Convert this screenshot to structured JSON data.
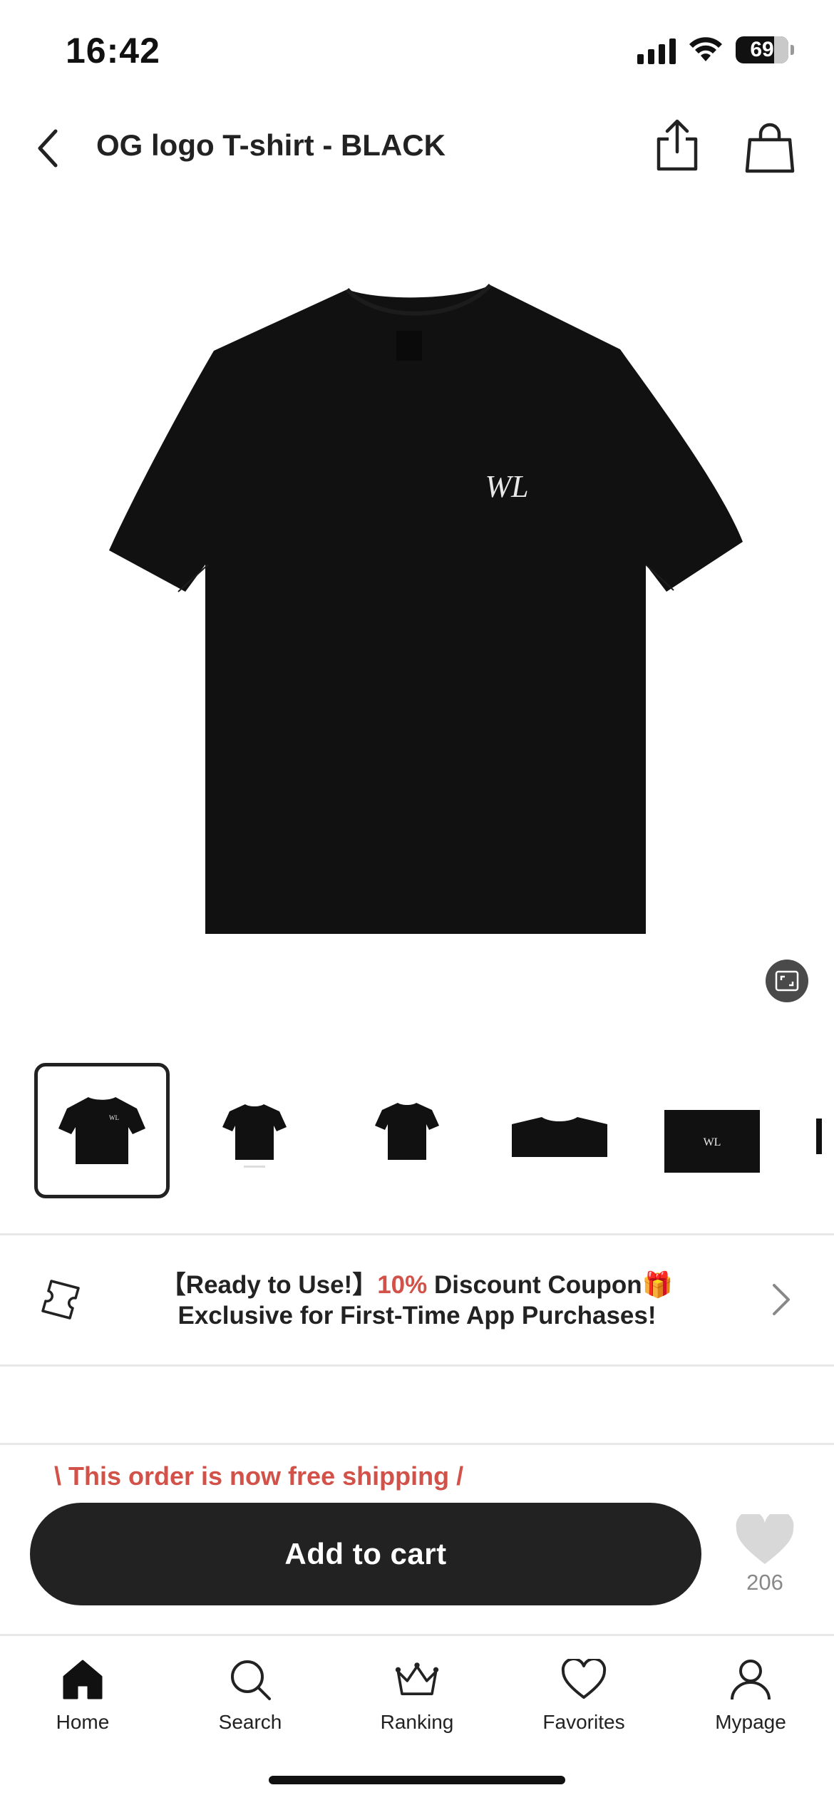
{
  "status_bar": {
    "time": "16:42",
    "battery": "69",
    "icons": [
      "signal-icon",
      "wifi-icon",
      "battery-icon"
    ]
  },
  "header": {
    "title": "OG logo T-shirt - BLACK",
    "icons": [
      "back-chevron-icon",
      "share-icon",
      "shopping-bag-icon"
    ]
  },
  "product": {
    "garment_color": "#111111",
    "logo": "WL",
    "thumbnails": [
      "front",
      "front-small",
      "back",
      "collar-detail",
      "logo-detail",
      "more"
    ],
    "selected_thumbnail": 0
  },
  "coupon": {
    "line1_prefix": "【Ready to Use!】",
    "line1_accent": "10%",
    "line1_suffix": " Discount Coupon🎁",
    "line2": "Exclusive for First-Time App Purchases!"
  },
  "purchase": {
    "free_shipping": "\\ This order is now free shipping /",
    "add_to_cart": "Add to cart",
    "favorite_count": "206"
  },
  "tabs": [
    {
      "label": "Home",
      "icon": "home-icon"
    },
    {
      "label": "Search",
      "icon": "search-icon"
    },
    {
      "label": "Ranking",
      "icon": "crown-icon"
    },
    {
      "label": "Favorites",
      "icon": "heart-icon"
    },
    {
      "label": "Mypage",
      "icon": "person-icon"
    }
  ],
  "colors": {
    "accent": "#d2524a",
    "dark": "#222222",
    "muted": "#888888"
  }
}
